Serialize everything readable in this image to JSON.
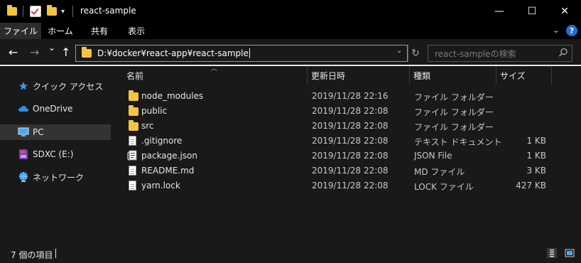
{
  "titlebar": {
    "title": "react-sample",
    "buttons": {
      "minimize": "—",
      "maximize": "☐",
      "close": "✕"
    }
  },
  "ribbon": {
    "tabs": [
      "ファイル",
      "ホーム",
      "共有",
      "表示"
    ],
    "active_tab": "ファイル",
    "help": "?"
  },
  "nav": {
    "back": "←",
    "forward": "→",
    "recent": "⌄",
    "up": "↑",
    "address": "D:¥docker¥react-app¥react-sample",
    "search_placeholder": "react-sampleの検索"
  },
  "sidebar": {
    "items": [
      {
        "label": "クイック アクセス",
        "icon": "star-icon"
      },
      {
        "label": "OneDrive",
        "icon": "cloud-icon"
      },
      {
        "label": "PC",
        "icon": "monitor-icon",
        "selected": true
      },
      {
        "label": "SDXC (E:)",
        "icon": "sd-card-icon"
      },
      {
        "label": "ネットワーク",
        "icon": "network-icon"
      }
    ]
  },
  "columns": {
    "name": "名前",
    "date": "更新日時",
    "type": "種類",
    "size": "サイズ"
  },
  "files": [
    {
      "name": "node_modules",
      "date": "2019/11/28 22:16",
      "type": "ファイル フォルダー",
      "size": "",
      "icon": "folder-icon"
    },
    {
      "name": "public",
      "date": "2019/11/28 22:08",
      "type": "ファイル フォルダー",
      "size": "",
      "icon": "folder-icon"
    },
    {
      "name": "src",
      "date": "2019/11/28 22:08",
      "type": "ファイル フォルダー",
      "size": "",
      "icon": "folder-icon"
    },
    {
      "name": ".gitignore",
      "date": "2019/11/28 22:08",
      "type": "テキスト ドキュメント",
      "size": "1 KB",
      "icon": "text-file-icon"
    },
    {
      "name": "package.json",
      "date": "2019/11/28 22:08",
      "type": "JSON File",
      "size": "1 KB",
      "icon": "json-file-icon"
    },
    {
      "name": "README.md",
      "date": "2019/11/28 22:08",
      "type": "MD ファイル",
      "size": "3 KB",
      "icon": "file-icon"
    },
    {
      "name": "yarn.lock",
      "date": "2019/11/28 22:08",
      "type": "LOCK ファイル",
      "size": "427 KB",
      "icon": "file-icon"
    }
  ],
  "status": {
    "item_count": "7 個の項目"
  },
  "colors": {
    "background": "#191919",
    "titlebar": "#000000",
    "folder": "#f4c542",
    "selected": "#333333",
    "accent": "#1e6fd9"
  }
}
